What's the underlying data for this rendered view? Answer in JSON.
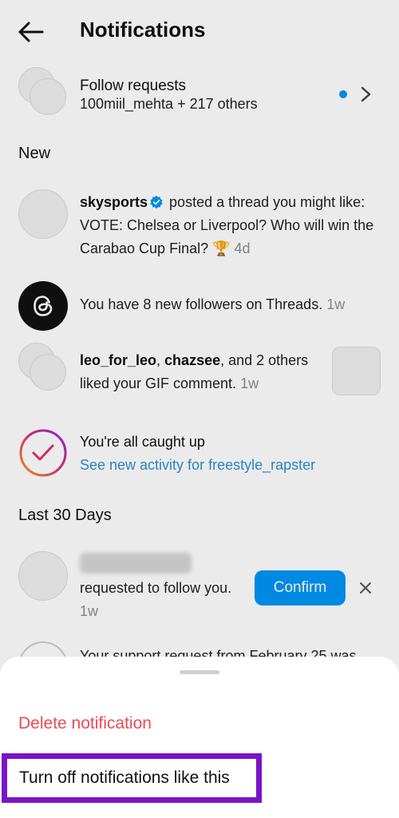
{
  "header": {
    "title": "Notifications",
    "back_icon": "arrow-left-icon"
  },
  "follow_requests": {
    "title": "Follow requests",
    "subtitle": "100miil_mehta + 217 others",
    "unread_dot_color": "#0095f6",
    "chevron_icon": "chevron-right-icon"
  },
  "sections": {
    "new": "New",
    "last_30_days": "Last 30 Days"
  },
  "notifications": [
    {
      "user": "skysports",
      "verified": true,
      "text": " posted a thread you might like: VOTE: Chelsea or Liverpool? Who will win the Carabao Cup Final? 🏆",
      "time": "4d"
    },
    {
      "text": "You have 8 new followers on Threads.",
      "time": "1w",
      "icon": "threads-logo-icon"
    },
    {
      "user1": "leo_for_leo",
      "sep": ", ",
      "user2": "chazsee",
      "text": ", and 2 others liked your GIF comment.",
      "time": "1w"
    }
  ],
  "caught_up": {
    "title": "You're all caught up",
    "link": "See new activity for freestyle_rapster",
    "icon": "checkmark-ring-icon"
  },
  "follow_request_item": {
    "text": "requested to follow you.",
    "time": "1w",
    "confirm_label": "Confirm",
    "dismiss_icon": "close-icon"
  },
  "support_item": {
    "text": "Your support request from February 25 was"
  },
  "sheet": {
    "delete_label": "Delete notification",
    "turn_off_label": "Turn off notifications like this"
  },
  "colors": {
    "accent_blue": "#0095f6",
    "link_blue": "#2c8fd6",
    "danger_red": "#ed4956",
    "highlight_purple": "#7a14c8"
  }
}
